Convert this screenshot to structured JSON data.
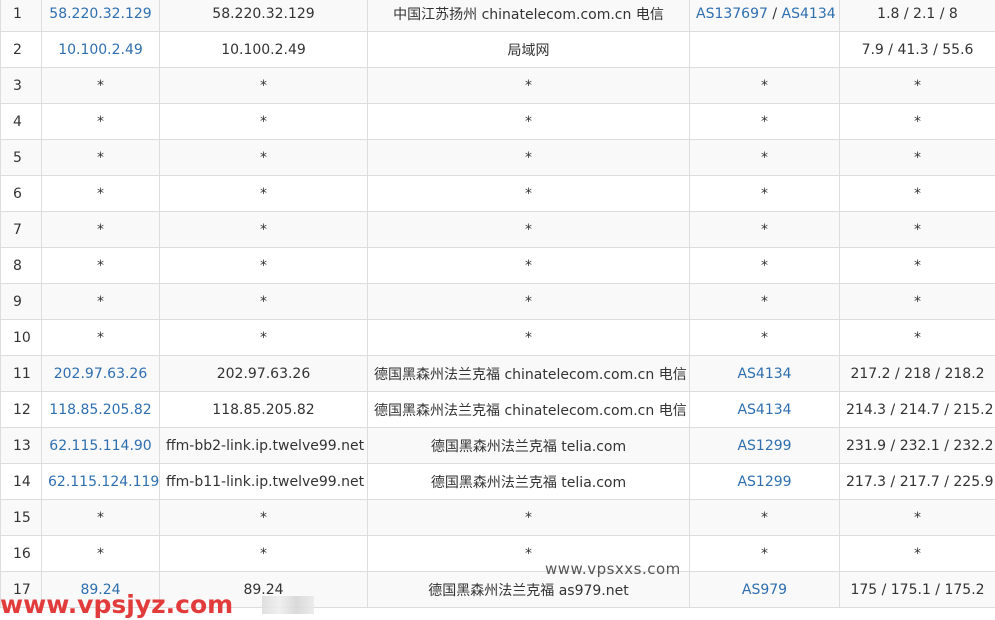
{
  "rows": [
    {
      "hop": "1",
      "ip": "58.220.32.129",
      "host": "58.220.32.129",
      "location": "中国江苏扬州 chinatelecom.com.cn 电信",
      "asn": [
        "AS137697",
        "AS4134"
      ],
      "rtt": "1.8 / 2.1 / 8"
    },
    {
      "hop": "2",
      "ip": "10.100.2.49",
      "host": "10.100.2.49",
      "location": "局域网",
      "asn": [],
      "rtt": "7.9 / 41.3 / 55.6"
    },
    {
      "hop": "3",
      "ip": "*",
      "host": "*",
      "location": "*",
      "asn": [
        "*"
      ],
      "rtt": "*"
    },
    {
      "hop": "4",
      "ip": "*",
      "host": "*",
      "location": "*",
      "asn": [
        "*"
      ],
      "rtt": "*"
    },
    {
      "hop": "5",
      "ip": "*",
      "host": "*",
      "location": "*",
      "asn": [
        "*"
      ],
      "rtt": "*"
    },
    {
      "hop": "6",
      "ip": "*",
      "host": "*",
      "location": "*",
      "asn": [
        "*"
      ],
      "rtt": "*"
    },
    {
      "hop": "7",
      "ip": "*",
      "host": "*",
      "location": "*",
      "asn": [
        "*"
      ],
      "rtt": "*"
    },
    {
      "hop": "8",
      "ip": "*",
      "host": "*",
      "location": "*",
      "asn": [
        "*"
      ],
      "rtt": "*"
    },
    {
      "hop": "9",
      "ip": "*",
      "host": "*",
      "location": "*",
      "asn": [
        "*"
      ],
      "rtt": "*"
    },
    {
      "hop": "10",
      "ip": "*",
      "host": "*",
      "location": "*",
      "asn": [
        "*"
      ],
      "rtt": "*"
    },
    {
      "hop": "11",
      "ip": "202.97.63.26",
      "host": "202.97.63.26",
      "location": "德国黑森州法兰克福 chinatelecom.com.cn 电信",
      "asn": [
        "AS4134"
      ],
      "rtt": "217.2 / 218 / 218.2"
    },
    {
      "hop": "12",
      "ip": "118.85.205.82",
      "host": "118.85.205.82",
      "location": "德国黑森州法兰克福 chinatelecom.com.cn 电信",
      "asn": [
        "AS4134"
      ],
      "rtt": "214.3 / 214.7 / 215.2"
    },
    {
      "hop": "13",
      "ip": "62.115.114.90",
      "host": "ffm-bb2-link.ip.twelve99.net",
      "location": "德国黑森州法兰克福 telia.com",
      "asn": [
        "AS1299"
      ],
      "rtt": "231.9 / 232.1 / 232.2"
    },
    {
      "hop": "14",
      "ip": "62.115.124.119",
      "host": "ffm-b11-link.ip.twelve99.net",
      "location": "德国黑森州法兰克福 telia.com",
      "asn": [
        "AS1299"
      ],
      "rtt": "217.3 / 217.7 / 225.9"
    },
    {
      "hop": "15",
      "ip": "*",
      "host": "*",
      "location": "*",
      "asn": [
        "*"
      ],
      "rtt": "*"
    },
    {
      "hop": "16",
      "ip": "*",
      "host": "*",
      "location": "*",
      "asn": [
        "*"
      ],
      "rtt": "*"
    },
    {
      "hop": "17",
      "ip": "89.24",
      "host": "89.24",
      "location": "德国黑森州法兰克福 as979.net",
      "asn": [
        "AS979"
      ],
      "rtt": "175 / 175.1 / 175.2"
    }
  ],
  "watermark_center": "www.vpsxxs.com",
  "watermark_corner": "www.vpsjyz.com",
  "colors": {
    "link": "#2f6fb0",
    "row_stripe": "#f9f9f9",
    "border": "#dddddd",
    "watermark_corner": "#e23b3b"
  }
}
